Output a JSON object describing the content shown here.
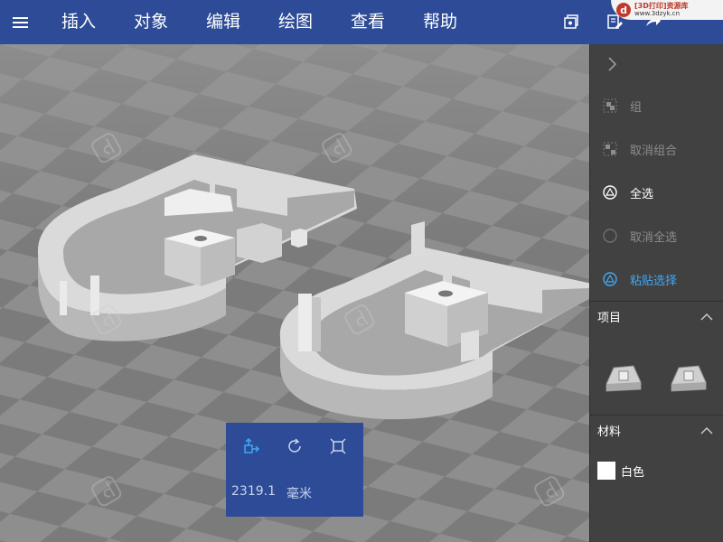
{
  "menu": {
    "items": [
      "插入",
      "对象",
      "编辑",
      "绘图",
      "查看",
      "帮助"
    ]
  },
  "badge": {
    "logo": "d",
    "line1": "[3D打印]资源库",
    "line2": "www.3dzyk.cn"
  },
  "watermark": {
    "text": "3D打印资源库",
    "sub": "www.3dzyk.cn"
  },
  "panel": {
    "actions": [
      {
        "label": "组",
        "state": "disabled",
        "icon": "group-icon"
      },
      {
        "label": "取消组合",
        "state": "disabled",
        "icon": "ungroup-icon"
      },
      {
        "label": "全选",
        "state": "enabled",
        "icon": "select-all-icon"
      },
      {
        "label": "取消全选",
        "state": "disabled",
        "icon": "deselect-all-icon"
      },
      {
        "label": "粘贴选择",
        "state": "active",
        "icon": "paste-selection-icon"
      }
    ],
    "items_header": "项目",
    "material_header": "材料",
    "material": {
      "label": "白色",
      "color": "#ffffff"
    }
  },
  "measure": {
    "value": "2319.1",
    "unit": "毫米"
  },
  "colors": {
    "menubar": "#2d4b96",
    "accent": "#3fa9f5",
    "panel": "#414141"
  }
}
